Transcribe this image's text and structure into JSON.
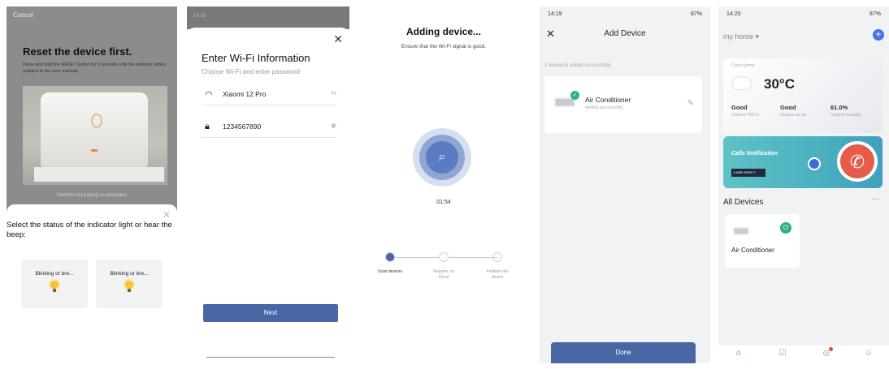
{
  "reset": {
    "cancel": "Cancel",
    "title": "Reset the device first.",
    "description": "Press and hold the RESET button for 5 seconds until the indicator blinks (subject to the user manual).",
    "prompt": "Perform net pairing as prompted",
    "question": "Select the status of the indicator light or hear the beep:",
    "options": [
      "Blinking or bre...",
      "Blinking or bre..."
    ]
  },
  "wifi": {
    "status_time": "14:19",
    "title": "Enter Wi-Fi Information",
    "subtitle": "Choose Wi-Fi and enter password",
    "ssid": "Xiaomi 12 Pro",
    "password": "1234567890",
    "next": "Next"
  },
  "adding": {
    "title": "Adding device...",
    "subtitle": "Ensure that the Wi-Fi signal is good.",
    "timer": "01:54",
    "steps": [
      "Scan devices",
      "Register on Cloud",
      "Initialize the device"
    ]
  },
  "add_device": {
    "status_time": "14:19",
    "status_right": "87%",
    "title": "Add Device",
    "success_count": "1 device(s) added successfully",
    "device_name": "Air Conditioner",
    "device_status": "Added successfully",
    "done": "Done"
  },
  "home": {
    "status_time": "14:20",
    "status_right": "87%",
    "home_name": "my home ▾",
    "cozy": "Cozy Home",
    "temperature": "30°C",
    "weather": [
      {
        "value": "Good",
        "label": "Outdoor PM2.5"
      },
      {
        "value": "Good",
        "label": "Outdoor air qu..."
      },
      {
        "value": "61.0%",
        "label": "Outdoor humidity"
      }
    ],
    "banner_title": "Calls Notification",
    "banner_button": "Learn more >",
    "all_devices": "All Devices",
    "more": "···",
    "device_name": "Air Conditioner"
  },
  "colors": {
    "accent": "#4967a5",
    "success": "#2db37a",
    "brand_blue": "#4a73e8"
  }
}
